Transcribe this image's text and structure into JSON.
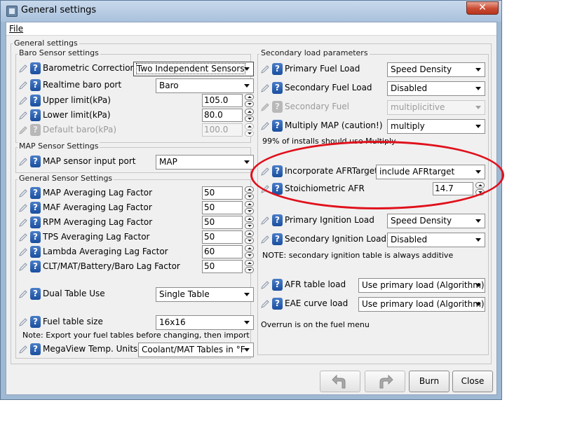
{
  "window": {
    "title": "General settings",
    "close_glyph": "✕"
  },
  "menu": {
    "file": "File"
  },
  "outer_panel_title": "General settings",
  "baro": {
    "title": "Baro Sensor settings",
    "barometric_correction": {
      "label": "Barometric Correction",
      "value": "Two Independent Sensors"
    },
    "realtime_baro_port": {
      "label": "Realtime baro port",
      "value": "Baro"
    },
    "upper_limit": {
      "label": "Upper limit(kPa)",
      "value": "105.0"
    },
    "lower_limit": {
      "label": "Lower limit(kPa)",
      "value": "80.0"
    },
    "default_baro": {
      "label": "Default baro(kPa)",
      "value": "100.0"
    }
  },
  "map": {
    "title": "MAP Sensor Settings",
    "input_port": {
      "label": "MAP sensor input port",
      "value": "MAP"
    }
  },
  "general": {
    "title": "General Sensor Settings",
    "factors": [
      {
        "label": "MAP Averaging Lag Factor",
        "value": "50"
      },
      {
        "label": "MAF Averaging Lag Factor",
        "value": "50"
      },
      {
        "label": "RPM Averaging Lag Factor",
        "value": "50"
      },
      {
        "label": "TPS Averaging Lag Factor",
        "value": "50"
      },
      {
        "label": "Lambda Averaging Lag Factor",
        "value": "60"
      },
      {
        "label": "CLT/MAT/Battery/Baro Lag Factor",
        "value": "50"
      }
    ],
    "dual_table": {
      "label": "Dual Table Use",
      "value": "Single Table"
    },
    "fuel_table_size": {
      "label": "Fuel table size",
      "value": "16x16"
    },
    "export_note": "Note: Export your fuel tables before changing, then import",
    "megaview_units": {
      "label": "MegaView Temp. Units",
      "value": "Coolant/MAT Tables in °F"
    }
  },
  "secondary": {
    "title": "Secondary load parameters",
    "primary_fuel_load": {
      "label": "Primary Fuel Load",
      "value": "Speed Density"
    },
    "secondary_fuel_load": {
      "label": "Secondary Fuel Load",
      "value": "Disabled"
    },
    "secondary_fuel": {
      "label": "Secondary Fuel",
      "value": "multiplicitive"
    },
    "multiply_map": {
      "label": "Multiply MAP (caution!)",
      "value": "multiply"
    },
    "multiply_note": "99% of installs should use Multiply",
    "incorporate_afr": {
      "label": "Incorporate AFRTarget",
      "value": "include AFRtarget"
    },
    "stoich_afr": {
      "label": "Stoichiometric AFR",
      "value": "14.7"
    },
    "primary_ign_load": {
      "label": "Primary Ignition Load",
      "value": "Speed Density"
    },
    "secondary_ign_load": {
      "label": "Secondary Ignition Load",
      "value": "Disabled"
    },
    "ign_note": "NOTE: secondary ignition table is always additive",
    "afr_table_load": {
      "label": "AFR table load",
      "value": "Use primary load (Algorithm)"
    },
    "eae_curve_load": {
      "label": "EAE curve load",
      "value": "Use primary load (Algorithm)"
    },
    "overrun_note": "Overrun is on the fuel menu"
  },
  "buttons": {
    "burn": "Burn",
    "close": "Close"
  },
  "icons": {
    "help": "?",
    "edit": "pencil-icon",
    "undo": "undo-arrow-icon",
    "redo": "redo-arrow-icon"
  },
  "colors": {
    "help_icon": "#1a4f9f",
    "annotation_ring": "#e0101b",
    "title_bar": "#a9c1dc"
  }
}
